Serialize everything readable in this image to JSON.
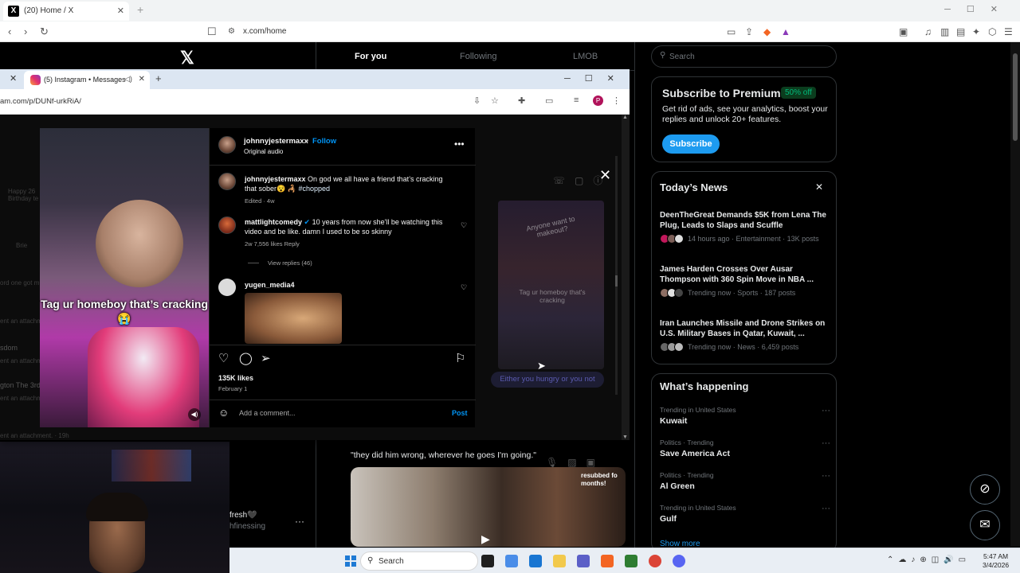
{
  "outer_browser": {
    "tab_title": "(20) Home / X",
    "tab_favicon": "X",
    "url": "x.com/home"
  },
  "x": {
    "tabs": [
      "For you",
      "Following",
      "LMOB"
    ],
    "search_placeholder": "Search",
    "premium": {
      "title": "Subscribe to Premium",
      "badge": "50% off",
      "description": "Get rid of ads, see your analytics, boost your replies and unlock 20+ features.",
      "button": "Subscribe"
    },
    "news": {
      "title": "Today’s News",
      "items": [
        {
          "headline": "DeenTheGreat Demands $5K from Lena The Plug, Leads to Slaps and Scuffle",
          "meta": "14 hours ago · Entertainment · 13K posts"
        },
        {
          "headline": "James Harden Crosses Over Ausar Thompson with 360 Spin Move in NBA ...",
          "meta": "Trending now · Sports · 187 posts"
        },
        {
          "headline": "Iran Launches Missile and Drone Strikes on U.S. Military Bases in Qatar, Kuwait, ...",
          "meta": "Trending now · News · 6,459 posts"
        }
      ]
    },
    "happening": {
      "title": "What’s happening",
      "trends": [
        {
          "category": "Trending in United States",
          "name": "Kuwait"
        },
        {
          "category": "Politics · Trending",
          "name": "Save America Act"
        },
        {
          "category": "Politics · Trending",
          "name": "Al Green"
        },
        {
          "category": "Trending in United States",
          "name": "Gulf"
        }
      ],
      "show_more": "Show more"
    },
    "tweet_text": "\"they did him wrong, wherever he goes I'm going.\"",
    "tweet_media_tag": "resubbed fo months!",
    "side_user_name": "fresh🖤",
    "side_user_handle": "hfinessing"
  },
  "inner_browser": {
    "tab_title": "(5) Instagram • Messages",
    "url": "am.com/p/DUNf-urkRiA/",
    "profile_initial": "P"
  },
  "ig_background": {
    "texts": [
      "Happy 26 Birthday te",
      "Brie",
      "ord one got m",
      "ent an attachm",
      "sdom",
      "ent an attachm",
      "gton The 3rd",
      "ent an attachm",
      "ent an attachment. · 19h"
    ],
    "right_caption_top": "Anyone want to makeout?",
    "right_caption_mid": "Tag ur homeboy that's cracking",
    "bubble_text": "Either you hungry or you not"
  },
  "ig_post": {
    "video_caption": "Tag ur homeboy that’s cracking😭",
    "author": "johnnyjestermaxx",
    "follow": "Follow",
    "audio": "Original audio",
    "caption_text": "On god we all have a friend that’s cracking that sober😵 🦂",
    "caption_tag": "#chopped",
    "caption_meta": "Edited · 4w",
    "comments": [
      {
        "user": "mattlightcomedy",
        "verified": true,
        "text": "10 years from now she'll be watching this video and be like. damn I used to be so skinny",
        "meta": "2w   7,556 likes   Reply"
      },
      {
        "user": "yugen_media4",
        "verified": false,
        "text": "",
        "meta": ""
      }
    ],
    "view_replies": "View replies (46)",
    "likes": "135K likes",
    "date": "February 1",
    "comment_placeholder": "Add a comment...",
    "post_button": "Post"
  },
  "taskbar": {
    "search": "Search",
    "time": "5:47 AM",
    "date": "3/4/2026"
  },
  "icons": {
    "colors": {
      "accent": "#1d9bf0",
      "ig_blue": "#0095f6",
      "premium_green": "#00ba7c"
    }
  }
}
